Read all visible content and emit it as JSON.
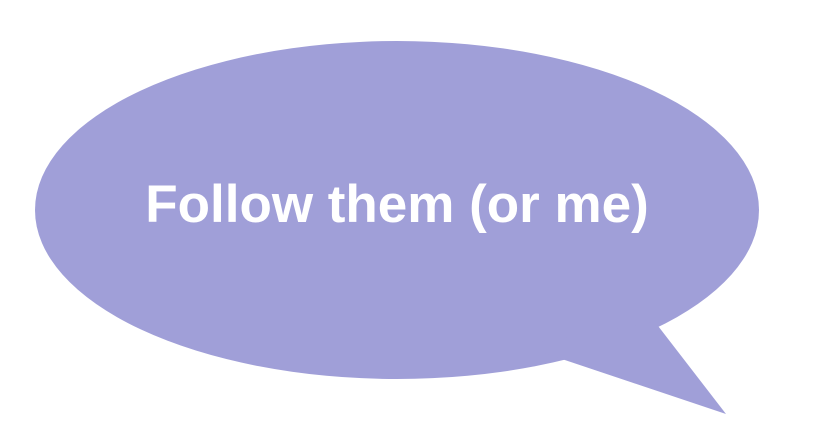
{
  "bubble": {
    "text": "Follow them (or me)",
    "fill_color": "#a09fd8",
    "text_color": "#ffffff"
  }
}
